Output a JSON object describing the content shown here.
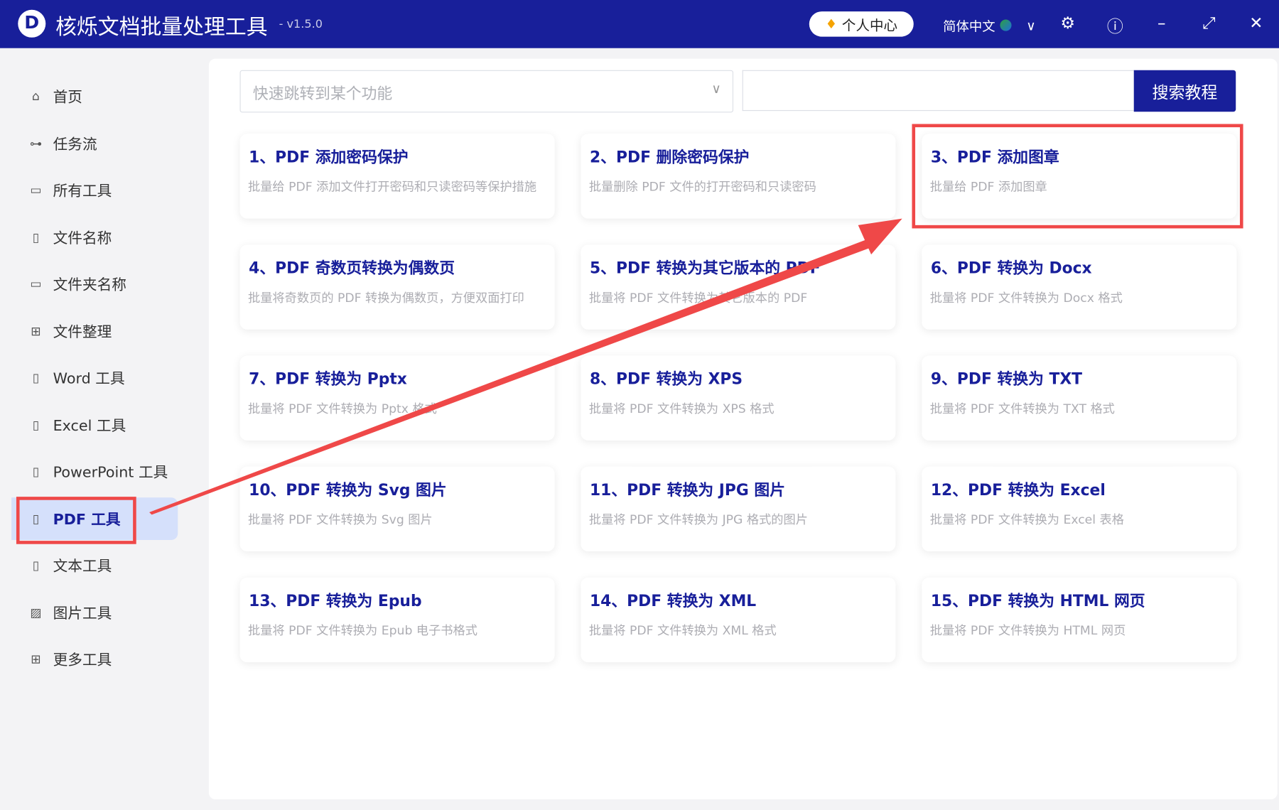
{
  "header": {
    "logo": "D",
    "title": "核烁文档批量处理工具",
    "version": "- v1.5.0",
    "personal_center": "个人中心",
    "language": "简体中文"
  },
  "sidebar": {
    "items": [
      {
        "label": "首页",
        "icon": "home-icon",
        "glyph": "⌂"
      },
      {
        "label": "任务流",
        "icon": "workflow-icon",
        "glyph": "⊶"
      },
      {
        "label": "所有工具",
        "icon": "monitor-icon",
        "glyph": "▭"
      },
      {
        "label": "文件名称",
        "icon": "file-icon",
        "glyph": "▯"
      },
      {
        "label": "文件夹名称",
        "icon": "folder-icon",
        "glyph": "▭"
      },
      {
        "label": "文件整理",
        "icon": "organize-icon",
        "glyph": "⊞"
      },
      {
        "label": "Word 工具",
        "icon": "word-icon",
        "glyph": "▯"
      },
      {
        "label": "Excel 工具",
        "icon": "excel-icon",
        "glyph": "▯"
      },
      {
        "label": "PowerPoint 工具",
        "icon": "powerpoint-icon",
        "glyph": "▯"
      },
      {
        "label": "PDF 工具",
        "icon": "pdf-icon",
        "glyph": "▯",
        "active": true
      },
      {
        "label": "文本工具",
        "icon": "text-icon",
        "glyph": "▯"
      },
      {
        "label": "图片工具",
        "icon": "image-icon",
        "glyph": "▨"
      },
      {
        "label": "更多工具",
        "icon": "grid-icon",
        "glyph": "⊞"
      }
    ]
  },
  "search": {
    "placeholder": "快速跳转到某个功能",
    "button": "搜索教程"
  },
  "cards": [
    {
      "title": "1、PDF 添加密码保护",
      "desc": "批量给 PDF 添加文件打开密码和只读密码等保护措施"
    },
    {
      "title": "2、PDF 删除密码保护",
      "desc": "批量删除 PDF 文件的打开密码和只读密码"
    },
    {
      "title": "3、PDF 添加图章",
      "desc": "批量给 PDF 添加图章"
    },
    {
      "title": "4、PDF 奇数页转换为偶数页",
      "desc": "批量将奇数页的 PDF 转换为偶数页，方便双面打印"
    },
    {
      "title": "5、PDF 转换为其它版本的 PDF",
      "desc": "批量将 PDF 文件转换为其它版本的 PDF"
    },
    {
      "title": "6、PDF 转换为 Docx",
      "desc": "批量将 PDF 文件转换为 Docx 格式"
    },
    {
      "title": "7、PDF 转换为 Pptx",
      "desc": "批量将 PDF 文件转换为 Pptx 格式"
    },
    {
      "title": "8、PDF 转换为 XPS",
      "desc": "批量将 PDF 文件转换为 XPS 格式"
    },
    {
      "title": "9、PDF 转换为 TXT",
      "desc": "批量将 PDF 文件转换为 TXT 格式"
    },
    {
      "title": "10、PDF 转换为 Svg 图片",
      "desc": "批量将 PDF 文件转换为 Svg 图片"
    },
    {
      "title": "11、PDF 转换为 JPG 图片",
      "desc": "批量将 PDF 文件转换为 JPG 格式的图片"
    },
    {
      "title": "12、PDF 转换为 Excel",
      "desc": "批量将 PDF 文件转换为 Excel 表格"
    },
    {
      "title": "13、PDF 转换为 Epub",
      "desc": "批量将 PDF 文件转换为 Epub 电子书格式"
    },
    {
      "title": "14、PDF 转换为 XML",
      "desc": "批量将 PDF 文件转换为 XML 格式"
    },
    {
      "title": "15、PDF 转换为 HTML 网页",
      "desc": "批量将 PDF 文件转换为 HTML 网页"
    }
  ],
  "colors": {
    "brand": "#181f9a",
    "highlight": "#ef4848",
    "active_bg": "#d5e0fb"
  }
}
